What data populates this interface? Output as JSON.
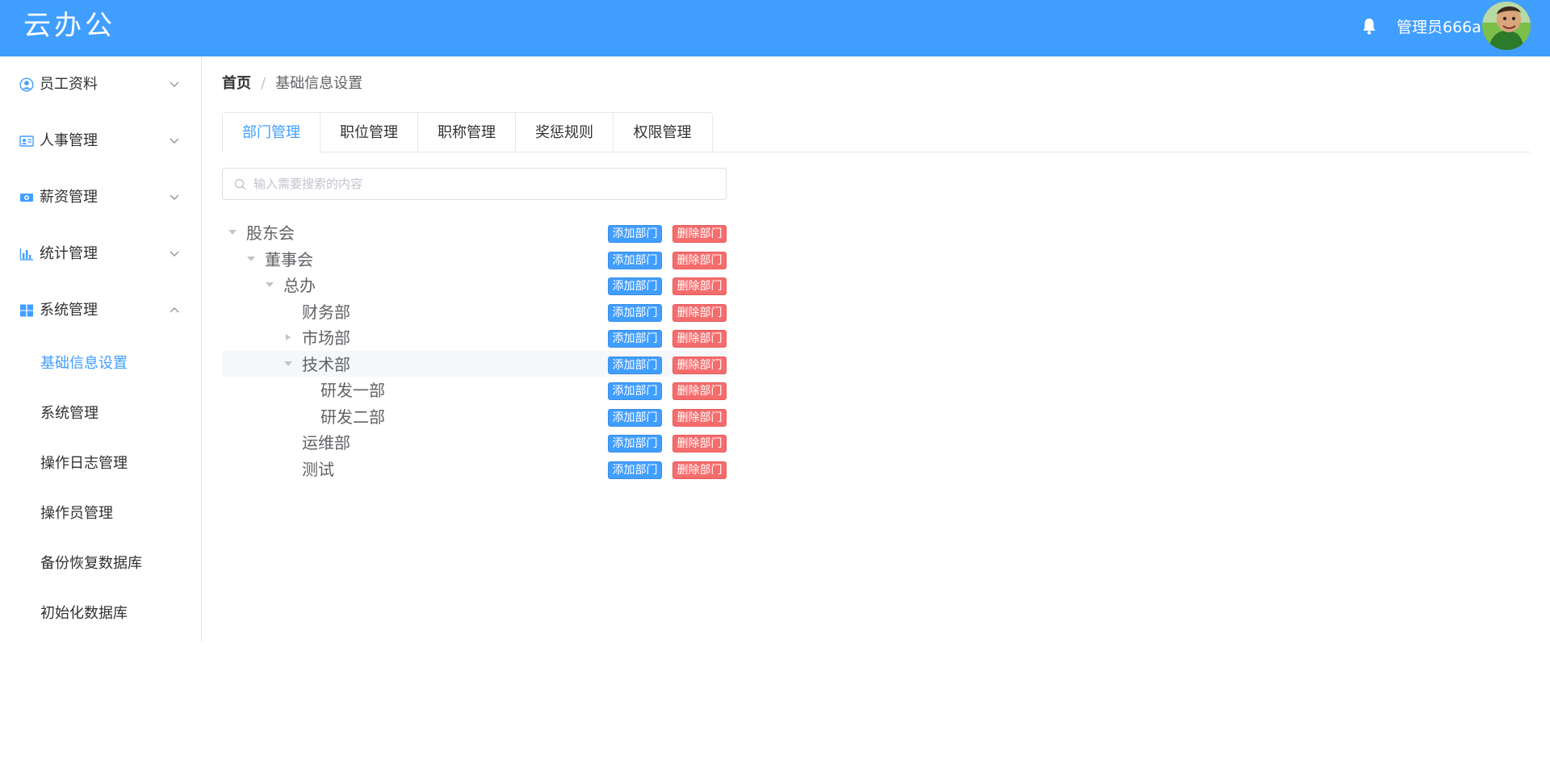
{
  "header": {
    "logo": "云办公",
    "username": "管理员666a",
    "bell_icon": "bell-icon",
    "brand_color": "#409eff"
  },
  "sidebar": {
    "menus": [
      {
        "label": "员工资料",
        "icon": "user-circle-icon",
        "expanded": false
      },
      {
        "label": "人事管理",
        "icon": "id-card-icon",
        "expanded": false
      },
      {
        "label": "薪资管理",
        "icon": "money-icon",
        "expanded": false
      },
      {
        "label": "统计管理",
        "icon": "bar-chart-icon",
        "expanded": false
      },
      {
        "label": "系统管理",
        "icon": "windows-icon",
        "expanded": true
      }
    ],
    "submenu": [
      {
        "label": "基础信息设置",
        "active": true
      },
      {
        "label": "系统管理",
        "active": false
      },
      {
        "label": "操作日志管理",
        "active": false
      },
      {
        "label": "操作员管理",
        "active": false
      },
      {
        "label": "备份恢复数据库",
        "active": false
      },
      {
        "label": "初始化数据库",
        "active": false
      }
    ]
  },
  "breadcrumb": {
    "home": "首页",
    "separator": "/",
    "current": "基础信息设置"
  },
  "tabs": [
    "部门管理",
    "职位管理",
    "职称管理",
    "奖惩规则",
    "权限管理"
  ],
  "active_tab": "部门管理",
  "search": {
    "placeholder": "输入需要搜索的内容",
    "value": ""
  },
  "tree": {
    "add_label": "添加部门",
    "delete_label": "删除部门",
    "nodes": [
      {
        "name": "股东会",
        "level": 0,
        "caret": "down"
      },
      {
        "name": "董事会",
        "level": 1,
        "caret": "down"
      },
      {
        "name": "总办",
        "level": 2,
        "caret": "down"
      },
      {
        "name": "财务部",
        "level": 3,
        "caret": "none"
      },
      {
        "name": "市场部",
        "level": 3,
        "caret": "right"
      },
      {
        "name": "技术部",
        "level": 3,
        "caret": "down",
        "highlighted": true
      },
      {
        "name": "研发一部",
        "level": 4,
        "caret": "none"
      },
      {
        "name": "研发二部",
        "level": 4,
        "caret": "none"
      },
      {
        "name": "运维部",
        "level": 3,
        "caret": "none"
      },
      {
        "name": "测试",
        "level": 3,
        "caret": "none"
      }
    ]
  }
}
